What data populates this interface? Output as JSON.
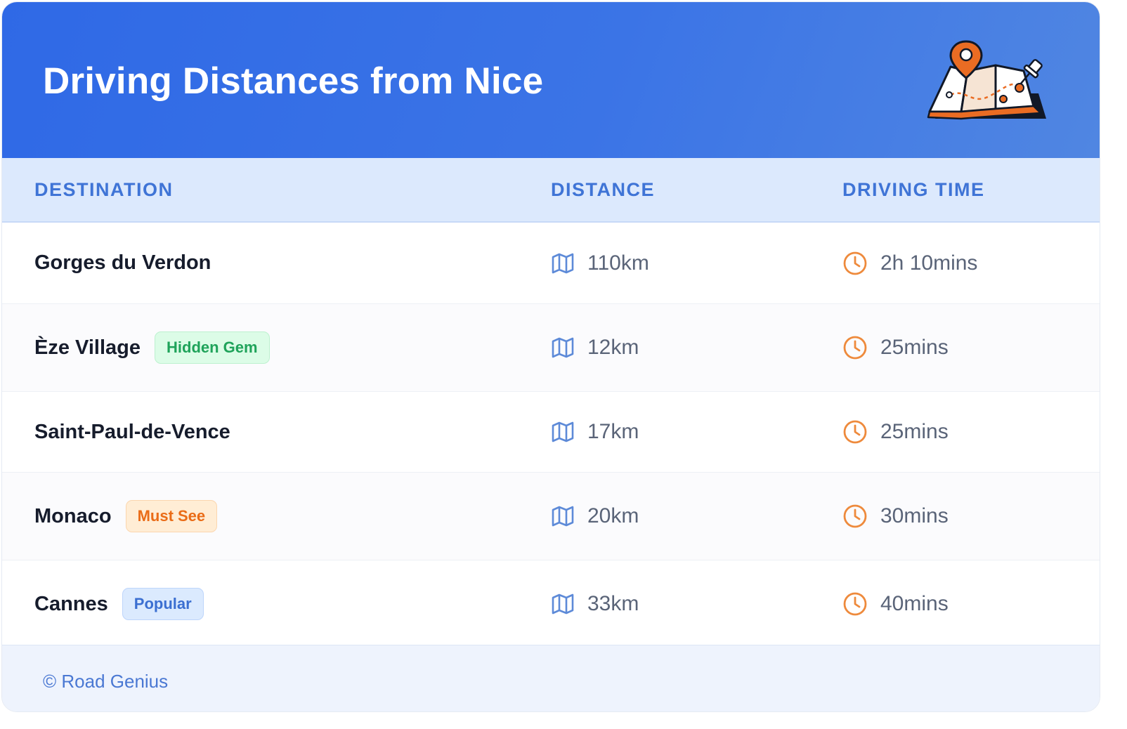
{
  "header": {
    "title": "Driving Distances from Nice",
    "illustration_icon": "map-with-pins-icon",
    "gradient_colors": [
      "#2f69e6",
      "#5086e2"
    ]
  },
  "table": {
    "columns": [
      "DESTINATION",
      "DISTANCE",
      "DRIVING TIME"
    ],
    "distance_icon": "map-icon",
    "time_icon": "clock-icon",
    "rows": [
      {
        "destination": "Gorges du Verdon",
        "badge": "",
        "badge_color": "",
        "distance": "110km",
        "time": "2h 10mins"
      },
      {
        "destination": "Èze Village",
        "badge": "Hidden Gem",
        "badge_color": "green",
        "distance": "12km",
        "time": "25mins"
      },
      {
        "destination": "Saint-Paul-de-Vence",
        "badge": "",
        "badge_color": "",
        "distance": "17km",
        "time": "25mins"
      },
      {
        "destination": "Monaco",
        "badge": "Must See",
        "badge_color": "orange",
        "distance": "20km",
        "time": "30mins"
      },
      {
        "destination": "Cannes",
        "badge": "Popular",
        "badge_color": "blue",
        "distance": "33km",
        "time": "40mins"
      }
    ]
  },
  "footer": {
    "text": "© Road Genius"
  },
  "colors": {
    "accent": "#3b74e6",
    "header_text": "#3f74d6",
    "clock": "#ee8a3c",
    "map_icon": "#5d8ad8"
  }
}
